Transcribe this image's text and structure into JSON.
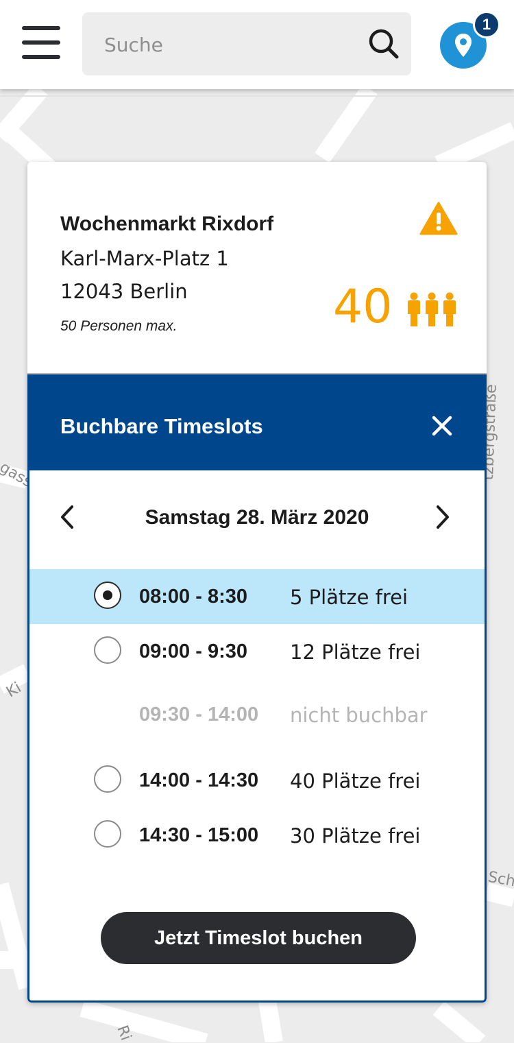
{
  "header": {
    "search_placeholder": "Suche",
    "location_badge": "1"
  },
  "map": {
    "street_labels": [
      "tzbergstraße",
      "gass",
      "Ki",
      "Sch",
      "Ri"
    ]
  },
  "market": {
    "name": "Wochenmarkt Rixdorf",
    "address_line1": "Karl-Marx-Platz 1",
    "address_line2": "12043 Berlin",
    "capacity": "50 Personen max.",
    "current_count": "40"
  },
  "timeslots": {
    "title": "Buchbare Timeslots",
    "date": "Samstag 28. März 2020",
    "slots": [
      {
        "time": "08:00 - 8:30",
        "availability": "5 Plätze frei",
        "selected": true,
        "bookable": true
      },
      {
        "time": "09:00 - 9:30",
        "availability": "12 Plätze frei",
        "selected": false,
        "bookable": true
      },
      {
        "time": "09:30 - 14:00",
        "availability": "nicht buchbar",
        "selected": false,
        "bookable": false
      },
      {
        "time": "14:00 - 14:30",
        "availability": "40 Plätze frei",
        "selected": false,
        "bookable": true
      },
      {
        "time": "14:30 - 15:00",
        "availability": "30 Plätze frei",
        "selected": false,
        "bookable": true
      }
    ],
    "book_button": "Jetzt Timeslot buchen"
  },
  "colors": {
    "accent_blue": "#00468c",
    "warning_orange": "#f6a200",
    "selected_row": "#bce6fa",
    "location_blue": "#1f93d6"
  },
  "icons": [
    "menu-icon",
    "search-icon",
    "location-pin-icon",
    "warning-icon",
    "people-icon",
    "close-icon",
    "chevron-left-icon",
    "chevron-right-icon"
  ]
}
